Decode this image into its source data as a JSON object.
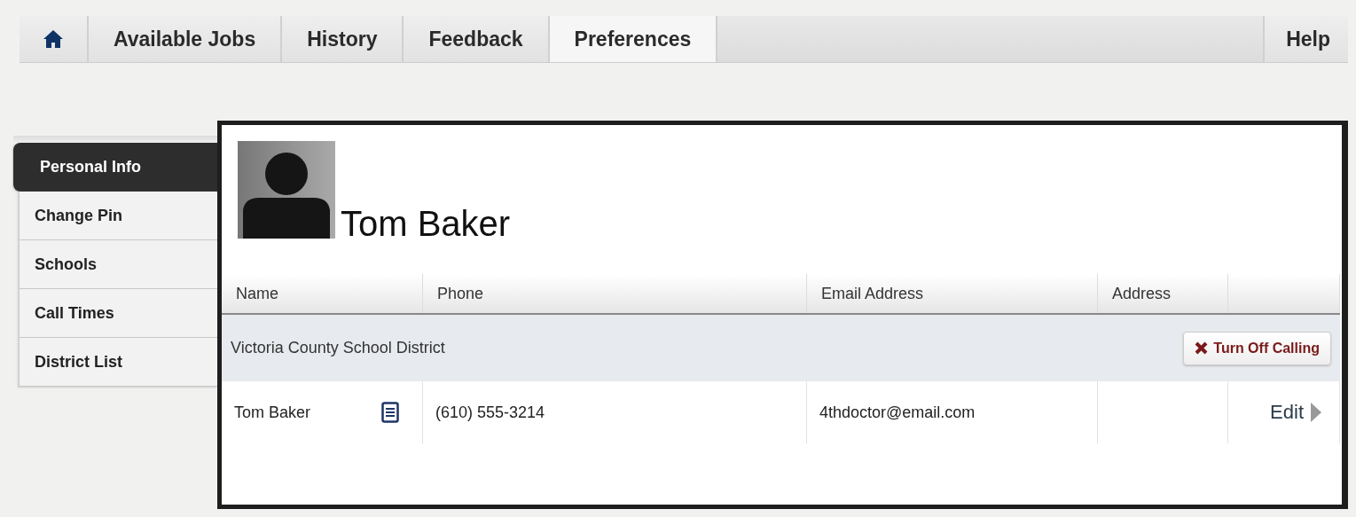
{
  "nav": {
    "tabs": [
      {
        "kind": "home",
        "selected": false
      },
      {
        "kind": "text",
        "label": "Available Jobs",
        "selected": false
      },
      {
        "kind": "text",
        "label": "History",
        "selected": false
      },
      {
        "kind": "text",
        "label": "Feedback",
        "selected": false
      },
      {
        "kind": "text",
        "label": "Preferences",
        "selected": true
      }
    ],
    "help": "Help"
  },
  "sidebar": {
    "items": [
      {
        "label": "Personal Info",
        "selected": true
      },
      {
        "label": "Change Pin",
        "selected": false
      },
      {
        "label": "Schools",
        "selected": false
      },
      {
        "label": "Call Times",
        "selected": false
      },
      {
        "label": "District List",
        "selected": false
      }
    ]
  },
  "profile": {
    "name": "Tom Baker"
  },
  "table": {
    "columns": [
      "Name",
      "Phone",
      "Email Address",
      "Address"
    ],
    "groups": [
      {
        "district": "Victoria County School District",
        "action": "Turn Off Calling",
        "rows": [
          {
            "name": "Tom Baker",
            "phone": "(610) 555-3214",
            "email": "4thdoctor@email.com",
            "action": "Edit"
          }
        ]
      }
    ]
  }
}
